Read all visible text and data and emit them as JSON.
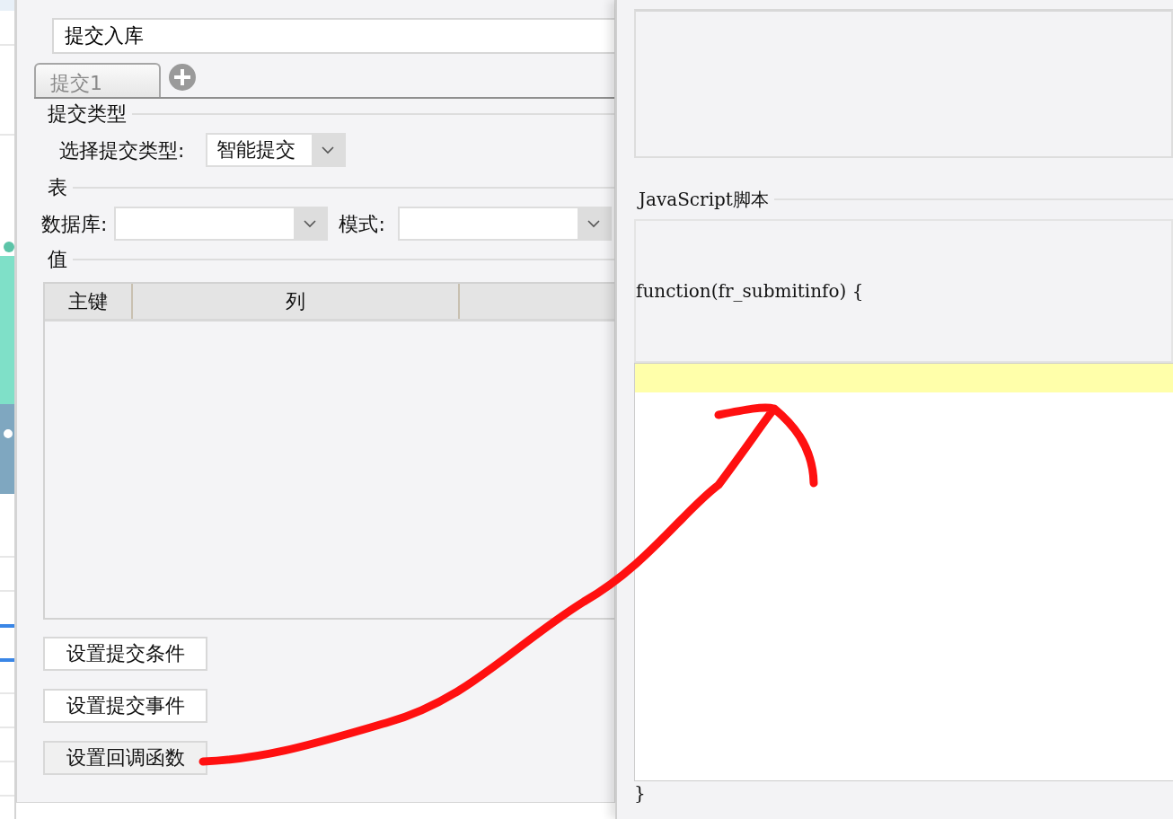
{
  "submit_name": {
    "value": "提交入库"
  },
  "tabs": [
    {
      "label": "提交1",
      "selected": true
    }
  ],
  "submit_type": {
    "legend": "提交类型",
    "label": "选择提交类型:",
    "value": "智能提交"
  },
  "table_section": {
    "legend": "表",
    "database_label": "数据库:",
    "schema_label": "模式:"
  },
  "values_section": {
    "legend": "值",
    "columns": [
      "主键",
      "列"
    ]
  },
  "buttons": [
    "设置提交条件",
    "设置提交事件",
    "设置回调函数"
  ],
  "script_panel": {
    "legend": "JavaScript脚本",
    "header_code": "function(fr_submitinfo) {",
    "footer_code": "}"
  }
}
